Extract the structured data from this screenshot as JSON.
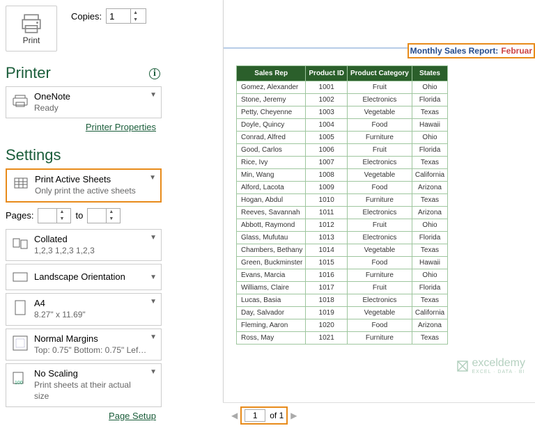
{
  "print": {
    "button_label": "Print",
    "copies_label": "Copies:",
    "copies_value": "1"
  },
  "printer": {
    "heading": "Printer",
    "name": "OneNote",
    "status": "Ready",
    "properties_link": "Printer Properties"
  },
  "settings": {
    "heading": "Settings",
    "active_sheets": {
      "title": "Print Active Sheets",
      "sub": "Only print the active sheets"
    },
    "pages_label": "Pages:",
    "pages_to": "to",
    "collated": {
      "title": "Collated",
      "sub": "1,2,3   1,2,3   1,2,3"
    },
    "orientation": "Landscape Orientation",
    "paper": {
      "title": "A4",
      "sub": "8.27\" x 11.69\""
    },
    "margins": {
      "title": "Normal Margins",
      "sub": "Top: 0.75\" Bottom: 0.75\" Lef…"
    },
    "scaling": {
      "title": "No Scaling",
      "sub": "Print sheets at their actual size"
    },
    "page_setup_link": "Page Setup"
  },
  "preview": {
    "title": "Monthly Sales Report:",
    "title_month": "Februar",
    "headers": [
      "Sales Rep",
      "Product ID",
      "Product Category",
      "States"
    ],
    "rows": [
      [
        "Gomez, Alexander",
        "1001",
        "Fruit",
        "Ohio"
      ],
      [
        "Stone, Jeremy",
        "1002",
        "Electronics",
        "Florida"
      ],
      [
        "Petty, Cheyenne",
        "1003",
        "Vegetable",
        "Texas"
      ],
      [
        "Doyle, Quincy",
        "1004",
        "Food",
        "Hawaii"
      ],
      [
        "Conrad, Alfred",
        "1005",
        "Furniture",
        "Ohio"
      ],
      [
        "Good, Carlos",
        "1006",
        "Fruit",
        "Florida"
      ],
      [
        "Rice, Ivy",
        "1007",
        "Electronics",
        "Texas"
      ],
      [
        "Min, Wang",
        "1008",
        "Vegetable",
        "California"
      ],
      [
        "Alford, Lacota",
        "1009",
        "Food",
        "Arizona"
      ],
      [
        "Hogan, Abdul",
        "1010",
        "Furniture",
        "Texas"
      ],
      [
        "Reeves, Savannah",
        "1011",
        "Electronics",
        "Arizona"
      ],
      [
        "Abbott, Raymond",
        "1012",
        "Fruit",
        "Ohio"
      ],
      [
        "Glass, Mufutau",
        "1013",
        "Electronics",
        "Florida"
      ],
      [
        "Chambers, Bethany",
        "1014",
        "Vegetable",
        "Texas"
      ],
      [
        "Green, Buckminster",
        "1015",
        "Food",
        "Hawaii"
      ],
      [
        "Evans, Marcia",
        "1016",
        "Furniture",
        "Ohio"
      ],
      [
        "Williams, Claire",
        "1017",
        "Fruit",
        "Florida"
      ],
      [
        "Lucas, Basia",
        "1018",
        "Electronics",
        "Texas"
      ],
      [
        "Day, Salvador",
        "1019",
        "Vegetable",
        "California"
      ],
      [
        "Fleming, Aaron",
        "1020",
        "Food",
        "Arizona"
      ],
      [
        "Ross, May",
        "1021",
        "Furniture",
        "Texas"
      ]
    ],
    "watermark": "exceldemy",
    "watermark_sub": "EXCEL · DATA · BI"
  },
  "pager": {
    "current": "1",
    "of_label": "of 1"
  }
}
